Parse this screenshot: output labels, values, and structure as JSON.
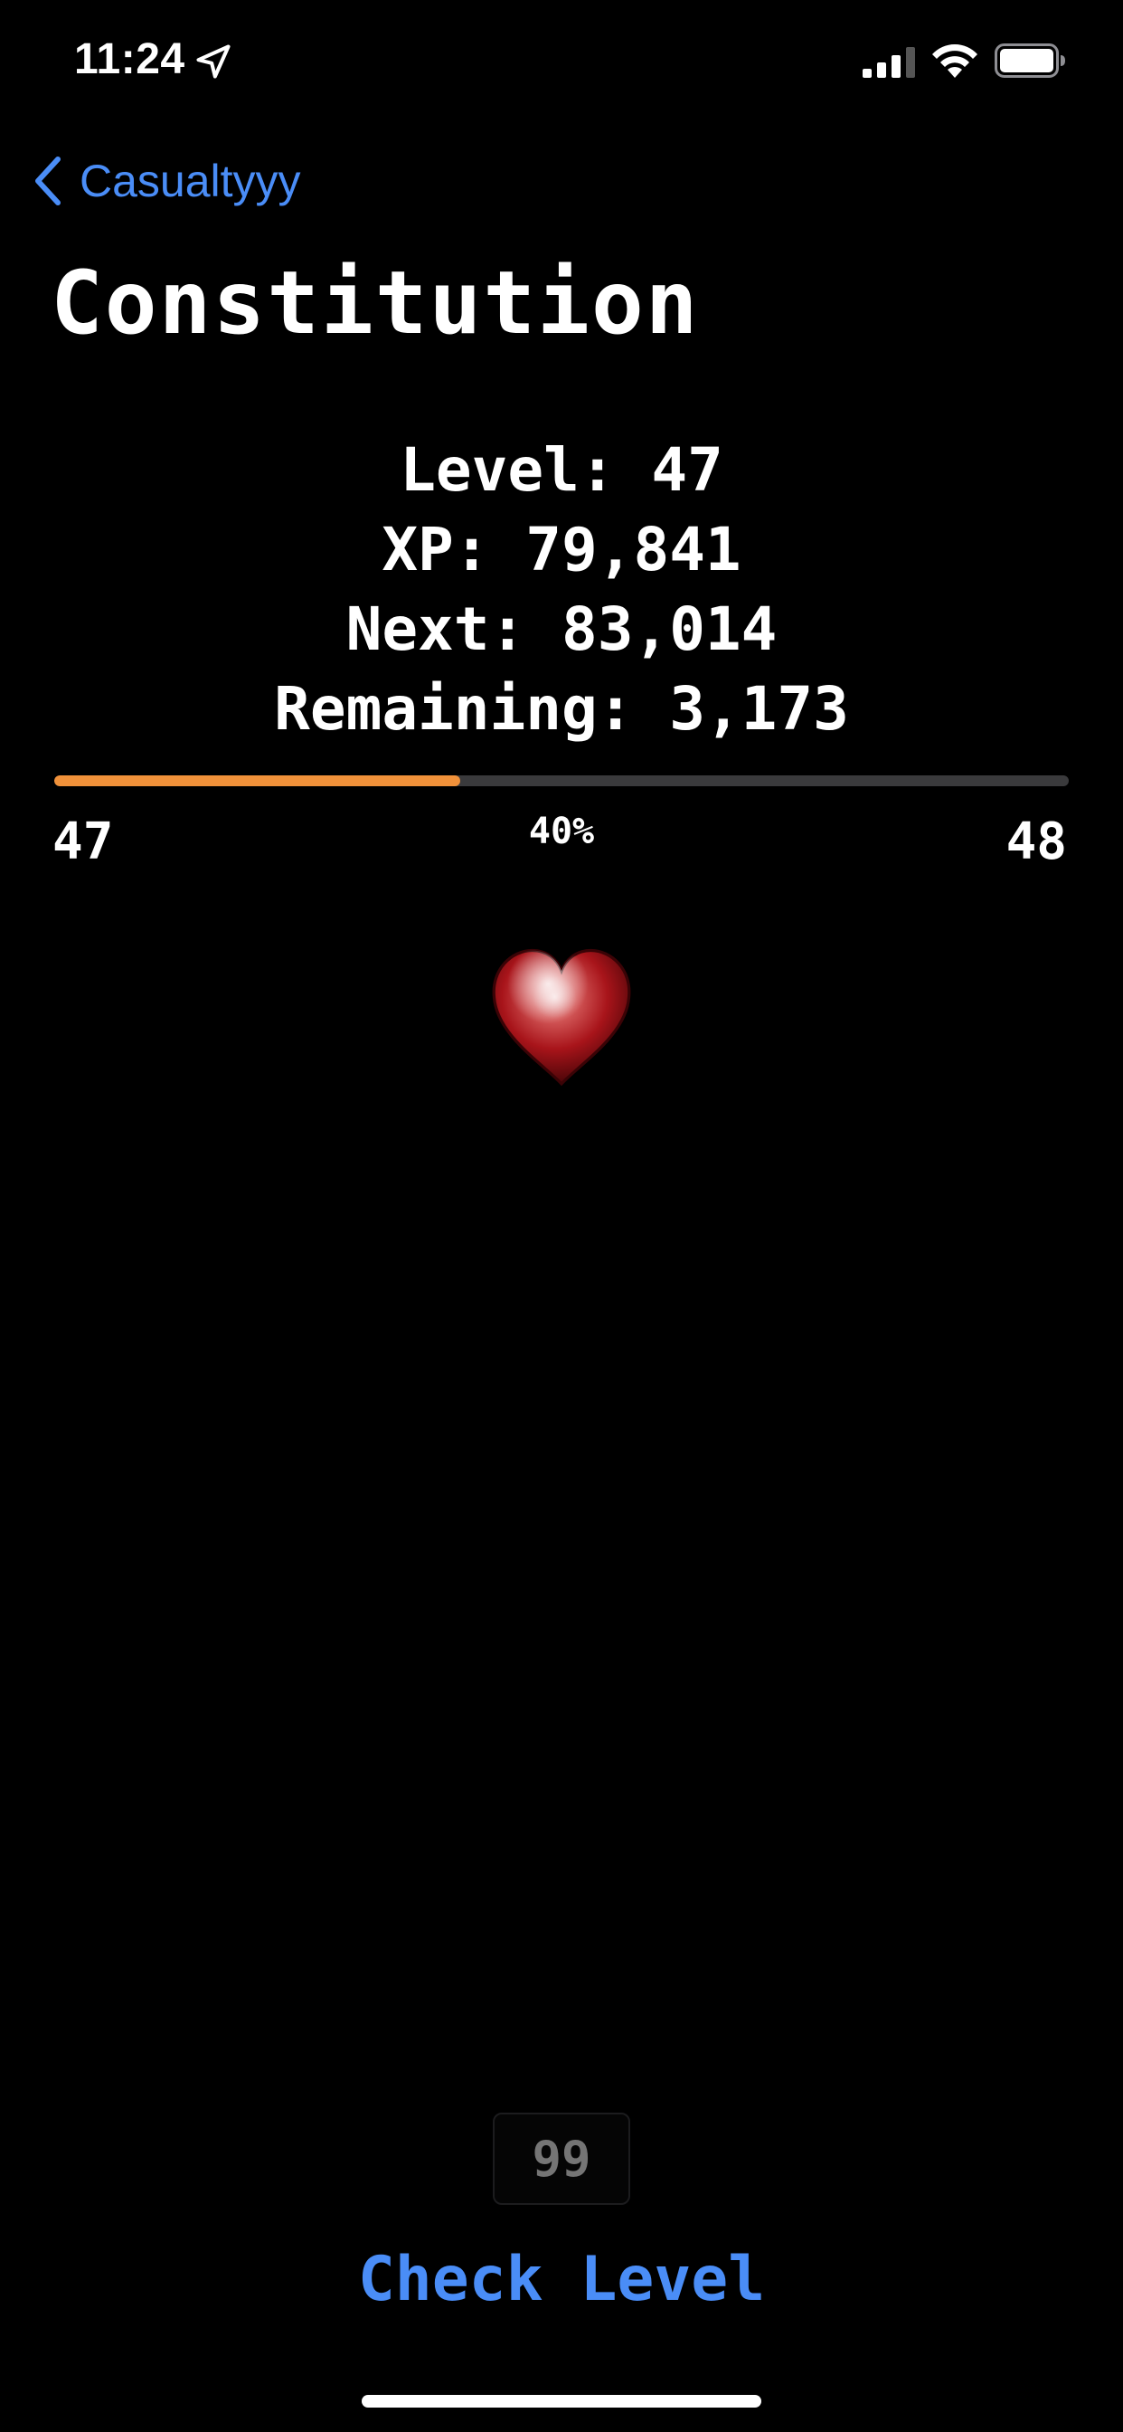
{
  "status_bar": {
    "time": "11:24"
  },
  "nav": {
    "back_label": "Casualtyyy"
  },
  "skill": {
    "title": "Constitution",
    "level_line": "Level: 47",
    "xp_line": "XP: 79,841",
    "next_line": "Next: 83,014",
    "remaining_line": "Remaining: 3,173"
  },
  "progress": {
    "current_level": "47",
    "next_level": "48",
    "percent_label": "40%",
    "fraction": 0.4,
    "fill_color": "#f0913a",
    "track_color": "#3a3a3c"
  },
  "skill_icon": "heart-icon",
  "level_input": {
    "placeholder": "99"
  },
  "actions": {
    "check_level_label": "Check Level"
  },
  "colors": {
    "accent": "#4a8df7",
    "background": "#000000"
  }
}
